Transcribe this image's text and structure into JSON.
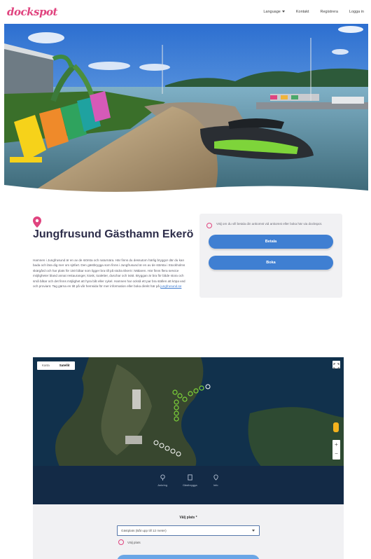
{
  "header": {
    "logo": "dockspot",
    "nav": [
      "Language",
      "Kontakt",
      "Registrera",
      "Logga in"
    ]
  },
  "listing": {
    "title": "Jungfrusund Gästhamn Ekerö",
    "description": "Hamnen i Jungfrusund är en av de största och naturnära. Här finns du dessutom härlig bryggor där du kan bada och lära dig mer om sjöfart. Den gästbrygga som finns i Jungfrusund är en av de största i Stockholms skärgård och har plats för 150 båtar som ligger bra till på södra Ekerö i Mälaren. Här finns flera service möjligheter bland annat restauranger, kiosk, toaletter, duschar och tvätt. Bryggan är bra för både stora och små båtar och det finns möjlighet att hyra båt eller cykel. Hamnen har också ett par bra ställen att köpa ved och proviant. Tag gärna en titt på vår hemsida för mer information eller boka direkt här på",
    "link_text": "jungfrusund.se"
  },
  "booking": {
    "info": "Välj om du vill betala din ankomst vid ankomst eller boka här via dockspot.",
    "primary_button": "Betala",
    "secondary_button": "Boka"
  },
  "map": {
    "tabs": [
      "Karta",
      "Satellit"
    ],
    "active_tab": "Satellit",
    "legend": [
      {
        "icon": "location-icon",
        "label": "Ankring"
      },
      {
        "icon": "dock-icon",
        "label": "Gästbrygga"
      },
      {
        "icon": "info-pin-icon",
        "label": "Info"
      }
    ]
  },
  "form": {
    "label": "Välj plats *",
    "select_value": "Gästplats (Båt upp till 12 meter)",
    "checkbox_label": "Välj plats"
  },
  "colors": {
    "brand": "#e0447f",
    "primary": "#3f7fd2"
  }
}
